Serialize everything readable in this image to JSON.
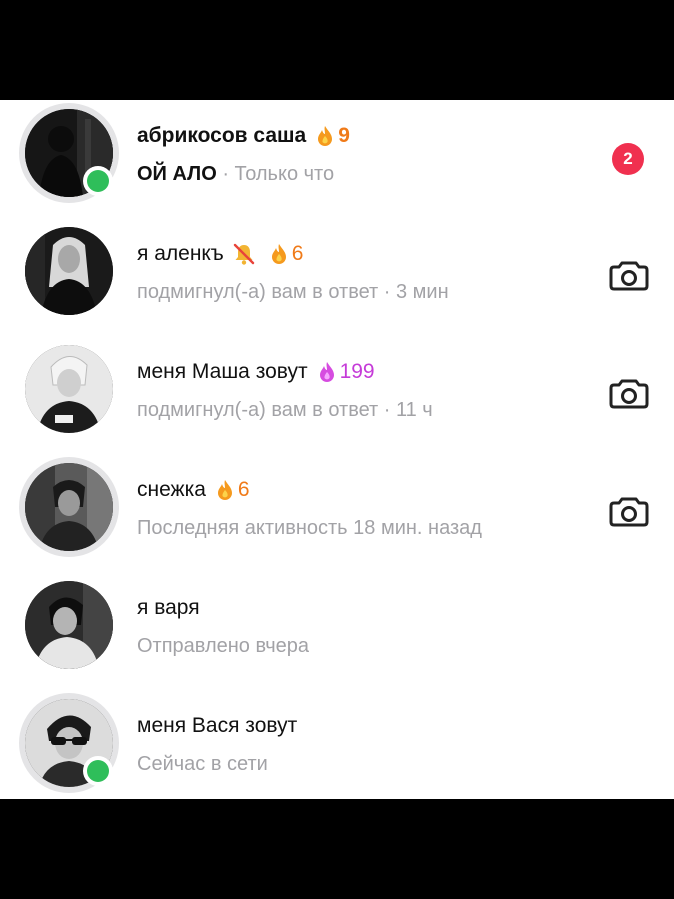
{
  "chats": [
    {
      "name": "абрикосов саша",
      "name_bold": true,
      "streak": "9",
      "streak_color": "#f07a18",
      "message": "ОЙ АЛО",
      "status": " · Только что",
      "online": true,
      "unread": "2",
      "action": "none"
    },
    {
      "name": "я аленкъ",
      "muted": true,
      "streak": "6",
      "streak_color": "#f07a18",
      "status": "подмигнул(-а) вам в ответ · 3 мин",
      "online": false,
      "action": "camera"
    },
    {
      "name": "меня Маша зовут",
      "streak": "199",
      "streak_color": "#c53bd8",
      "status": "подмигнул(-а) вам в ответ · 11 ч",
      "online": false,
      "action": "camera"
    },
    {
      "name": "снежка",
      "streak": "6",
      "streak_color": "#f07a18",
      "status": "Последняя активность 18 мин. назад",
      "online": false,
      "action": "camera"
    },
    {
      "name": "я варя",
      "status": "Отправлено вчера",
      "online": false,
      "action": "none"
    },
    {
      "name": "меня Вася зовут",
      "status": "Сейчас в сети",
      "online": true,
      "action": "none"
    }
  ],
  "icons": {
    "flame": "flame-icon",
    "camera": "camera-icon",
    "mute": "mute-bell-icon"
  },
  "colors": {
    "online": "#2fbe5a",
    "unread_badge": "#f0304f",
    "secondary_text": "#a2a2a6"
  }
}
